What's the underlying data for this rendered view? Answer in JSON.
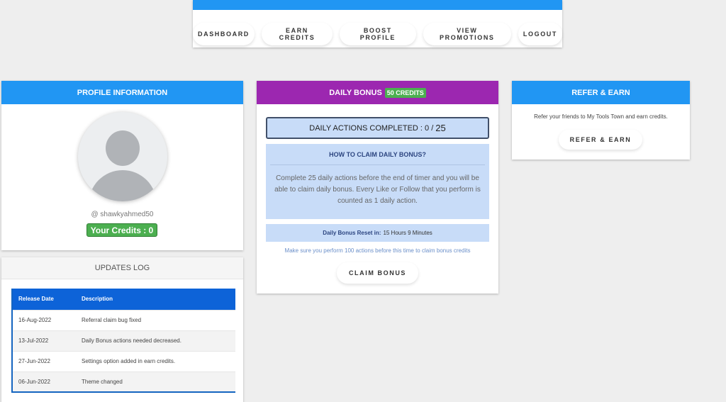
{
  "nav": {
    "items": [
      "DASHBOARD",
      "EARN CREDITS",
      "BOOST PROFILE",
      "VIEW PROMOTIONS",
      "LOGOUT"
    ]
  },
  "profile": {
    "title": "PROFILE INFORMATION",
    "username": "@ shawkyahmed50",
    "credits_label": "Your Credits : 0"
  },
  "updates": {
    "title": "UPDATES LOG",
    "headers": [
      "Release Date",
      "Description"
    ],
    "rows": [
      {
        "date": "16-Aug-2022",
        "desc": "Referral claim bug fixed"
      },
      {
        "date": "13-Jul-2022",
        "desc": "Daily Bonus actions needed decreased."
      },
      {
        "date": "27-Jun-2022",
        "desc": "Settings option added in earn credits."
      },
      {
        "date": "06-Jun-2022",
        "desc": "Theme changed"
      }
    ]
  },
  "daily": {
    "title": "DAILY BONUS",
    "badge": "50 CREDITS",
    "actions_label": "DAILY ACTIONS COMPLETED : 0 /",
    "actions_total": "25",
    "howto_title": "HOW TO CLAIM DAILY BONUS?",
    "howto_text": "Complete 25 daily actions before the end of timer and you will be able to claim daily bonus. Every Like or Follow that you perform is counted as 1 daily action.",
    "reset_label": "Daily Bonus Reset in:",
    "reset_value": "15 Hours 9 Minutes",
    "note": "Make sure you perform 100 actions before this time to claim bonus credits",
    "claim_label": "CLAIM BONUS"
  },
  "refer": {
    "title": "REFER & EARN",
    "text": "Refer your friends to My Tools Town and earn credits.",
    "button_label": "REFER & EARN"
  },
  "colors": {
    "primary": "#2196f3",
    "purple": "#9c27b0",
    "green": "#4caf50",
    "table_header": "#0d63d8",
    "light_blue": "#c8dcf8"
  }
}
